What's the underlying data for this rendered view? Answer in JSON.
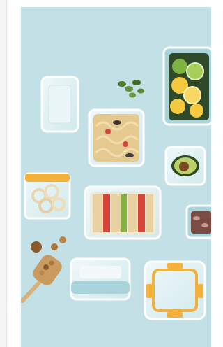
{
  "image": {
    "subject": "food-storage-containers-flatlay",
    "colors": {
      "background": "#c2e0e5",
      "glass": "#e6f3f5",
      "lid_blue": "#a9d4dc",
      "lid_orange": "#f3b03a",
      "avocado": "#7ea33b",
      "lime": "#7fb241",
      "lemon": "#f4c83f",
      "tomato": "#d7453b",
      "bread": "#e9d2a1"
    }
  }
}
